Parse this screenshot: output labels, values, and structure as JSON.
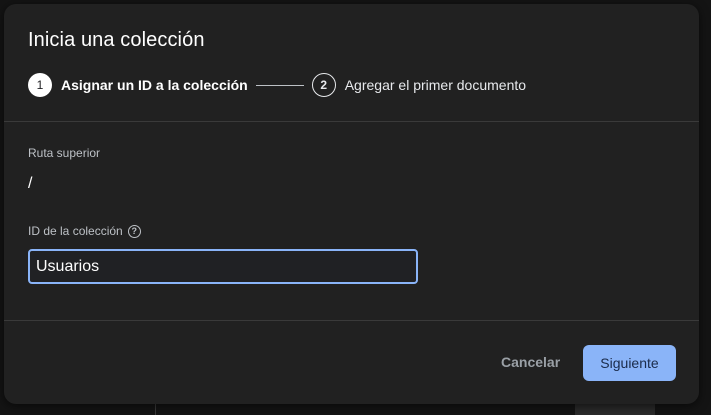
{
  "dialog": {
    "title": "Inicia una colección",
    "steps": [
      {
        "number": "1",
        "label": "Asignar un ID a la colección",
        "active": true
      },
      {
        "number": "2",
        "label": "Agregar el primer documento",
        "active": false
      }
    ],
    "parent_path": {
      "label": "Ruta superior",
      "value": "/"
    },
    "collection_id": {
      "label": "ID de la colección",
      "help_icon": "help-circle-icon",
      "value": "Usuarios"
    },
    "buttons": {
      "cancel": "Cancelar",
      "next": "Siguiente"
    }
  },
  "colors": {
    "accent": "#8ab4f8",
    "surface": "#212121"
  }
}
